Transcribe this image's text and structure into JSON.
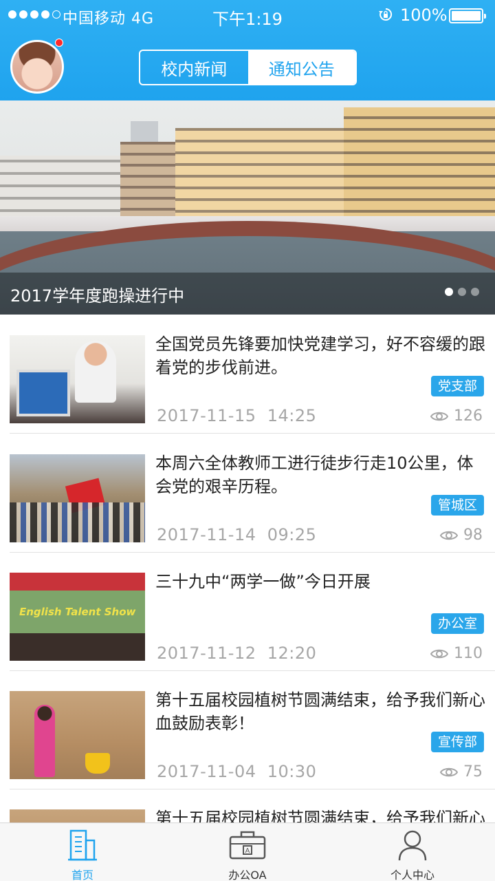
{
  "status_bar": {
    "carrier": "中国移动",
    "network": "4G",
    "time": "下午1:19",
    "battery": "100%"
  },
  "header": {
    "tabs": [
      {
        "label": "校内新闻",
        "active": true
      },
      {
        "label": "通知公告",
        "active": false
      }
    ],
    "has_notification": true
  },
  "banner": {
    "caption": "2017学年度跑操进行中",
    "slide_count": 3,
    "current_slide": 1
  },
  "news": [
    {
      "title": "全国党员先锋要加快党建学习，好不容缓的跟着党的步伐前进。",
      "tag": "党支部",
      "date": "2017-11-15",
      "time": "14:25",
      "views": "126"
    },
    {
      "title": "本周六全体教师工进行徒步行走10公里，体会党的艰辛历程。",
      "tag": "管城区",
      "date": "2017-11-14",
      "time": "09:25",
      "views": "98"
    },
    {
      "title": "三十九中“两学一做”今日开展",
      "tag": "办公室",
      "date": "2017-11-12",
      "time": "12:20",
      "views": "110"
    },
    {
      "title": "第十五届校园植树节圆满结束，给予我们新心血鼓励表彰！",
      "tag": "宣传部",
      "date": "2017-11-04",
      "time": "10:30",
      "views": "75"
    },
    {
      "title": "第十五届校园植树节圆满结束，给予我们新心血鼓励表彰！",
      "tag": "",
      "date": "",
      "time": "",
      "views": ""
    }
  ],
  "tabbar": {
    "items": [
      {
        "label": "首页",
        "icon": "home-building-icon",
        "active": true
      },
      {
        "label": "办公OA",
        "icon": "briefcase-icon",
        "active": false
      },
      {
        "label": "个人中心",
        "icon": "person-icon",
        "active": false
      }
    ]
  },
  "colors": {
    "accent": "#1fa3ee",
    "tag_bg": "#2aa6ea",
    "badge": "#ff2a2a",
    "muted_text": "#a6a6a6"
  }
}
